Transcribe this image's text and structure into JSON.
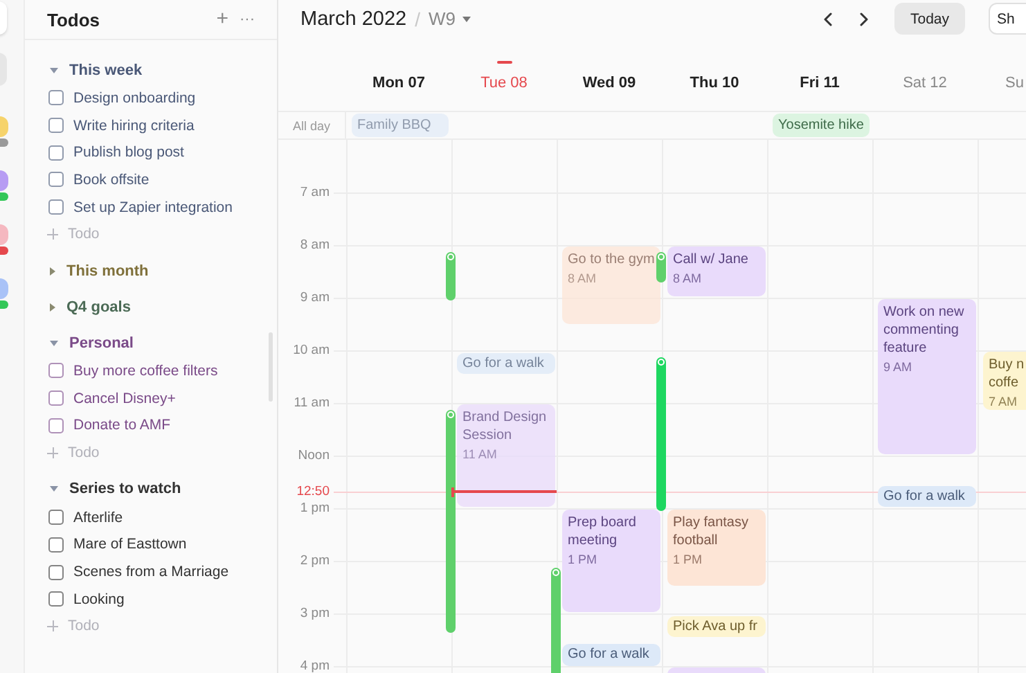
{
  "rail": [
    {
      "kind": "app",
      "selected": false
    },
    {
      "kind": "app",
      "selected": true
    },
    {
      "kind": "avatar",
      "color": "#f6d36b",
      "status": {
        "color": "#9a9a9a"
      }
    },
    {
      "kind": "avatar",
      "color": "#b79cf3",
      "status": {
        "color": "#34c759"
      }
    },
    {
      "kind": "avatar",
      "color": "#f5b8c0",
      "status": {
        "color": "#e5484d"
      }
    },
    {
      "kind": "avatar",
      "color": "#a9c2f7",
      "status": {
        "color": "#34c759"
      }
    }
  ],
  "sidebar": {
    "title": "Todos",
    "add_icon": "+",
    "more_icon": "···",
    "groups": [
      {
        "title": "This week",
        "color": "#4a5877",
        "expanded": true,
        "items": [
          {
            "text": "Design onboarding",
            "checked": false
          },
          {
            "text": "Write hiring criteria",
            "checked": false
          },
          {
            "text": "Publish blog post",
            "checked": false
          },
          {
            "text": "Book offsite",
            "checked": false
          },
          {
            "text": "Set up Zapier integration",
            "checked": false
          }
        ],
        "add_label": "Todo"
      },
      {
        "title": "This month",
        "color": "#7f703a",
        "expanded": false
      },
      {
        "title": "Q4 goals",
        "color": "#4b6a55",
        "expanded": false
      },
      {
        "title": "Personal",
        "color": "#7a4a88",
        "expanded": true,
        "items": [
          {
            "text": "Buy more coffee filters",
            "checked": false
          },
          {
            "text": "Cancel Disney+",
            "checked": false
          },
          {
            "text": "Donate to AMF",
            "checked": false
          }
        ],
        "add_label": "Todo"
      },
      {
        "title": "Series to watch",
        "color": "#333333",
        "expanded": true,
        "items": [
          {
            "text": "Afterlife",
            "checked": false
          },
          {
            "text": "Mare of Easttown",
            "checked": false
          },
          {
            "text": "Scenes from a Marriage",
            "checked": false
          },
          {
            "text": "Looking",
            "checked": false
          }
        ],
        "add_label": "Todo"
      }
    ]
  },
  "calendar": {
    "month": "March 2022",
    "separator": "/",
    "week": "W9",
    "today_button": "Today",
    "share_button": "Sh",
    "all_day_label": "All day",
    "hours": [
      "7 am",
      "8 am",
      "9 am",
      "10 am",
      "11 am",
      "Noon",
      "1 pm",
      "2 pm",
      "3 pm",
      "4 pm"
    ],
    "now": {
      "label": "12:50"
    },
    "days": [
      {
        "label": "Mon 07",
        "today": false,
        "weekend": false,
        "all_day": [
          {
            "title": "Family BBQ",
            "color": "#dde9f8",
            "past": true
          }
        ],
        "tracks": [
          {
            "color": "#5fd06b"
          },
          {
            "color": "#5fd06b"
          }
        ]
      },
      {
        "label": "Tue 08",
        "today": true,
        "weekend": false,
        "events": [
          {
            "title": "Go for a walk",
            "color": "#dde9f8",
            "past": true
          },
          {
            "title": "Brand Design Session",
            "time": "11 AM",
            "color": "#e9dbfb",
            "past": true
          }
        ],
        "tracks": [
          {
            "color": "#5fd06b"
          }
        ]
      },
      {
        "label": "Wed 09",
        "today": false,
        "weekend": false,
        "events": [
          {
            "title": "Go to the gym",
            "time": "8 AM",
            "color": "#fde5d6",
            "past": true
          },
          {
            "title": "Prep board meeting",
            "time": "1 PM",
            "color": "#e9dbfb",
            "past": false
          },
          {
            "title": "Go for a walk",
            "color": "#dde9f8",
            "past": false
          }
        ],
        "tracks": [
          {
            "color": "#5fd06b"
          },
          {
            "color": "#1ed760"
          }
        ]
      },
      {
        "label": "Thu 10",
        "today": false,
        "weekend": false,
        "events": [
          {
            "title": "Call w/ Jane",
            "time": "8 AM",
            "color": "#e9dbfb",
            "past": false
          },
          {
            "title": "Play fantasy football",
            "time": "1 PM",
            "color": "#fde5d6",
            "past": false
          },
          {
            "title": "Pick Ava up fr",
            "color": "#fdf4cf",
            "past": false
          },
          {
            "color": "#e9dbfb"
          }
        ]
      },
      {
        "label": "Fri 11",
        "today": false,
        "weekend": false,
        "all_day": [
          {
            "title": "Yosemite hike",
            "color": "#dcf4e1",
            "past": false
          }
        ]
      },
      {
        "label": "Sat 12",
        "today": false,
        "weekend": true,
        "events": [
          {
            "title": "Work on new commenting feature",
            "time": "9 AM",
            "color": "#e9dbfb",
            "past": false
          },
          {
            "title": "Go for a walk",
            "color": "#dde9f8",
            "past": false
          }
        ]
      },
      {
        "label": "Su",
        "today": false,
        "weekend": true,
        "events": [
          {
            "title": "Buy n\ncoffe",
            "time": "7 AM",
            "color": "#fdf4cf",
            "past": false
          }
        ]
      }
    ]
  }
}
